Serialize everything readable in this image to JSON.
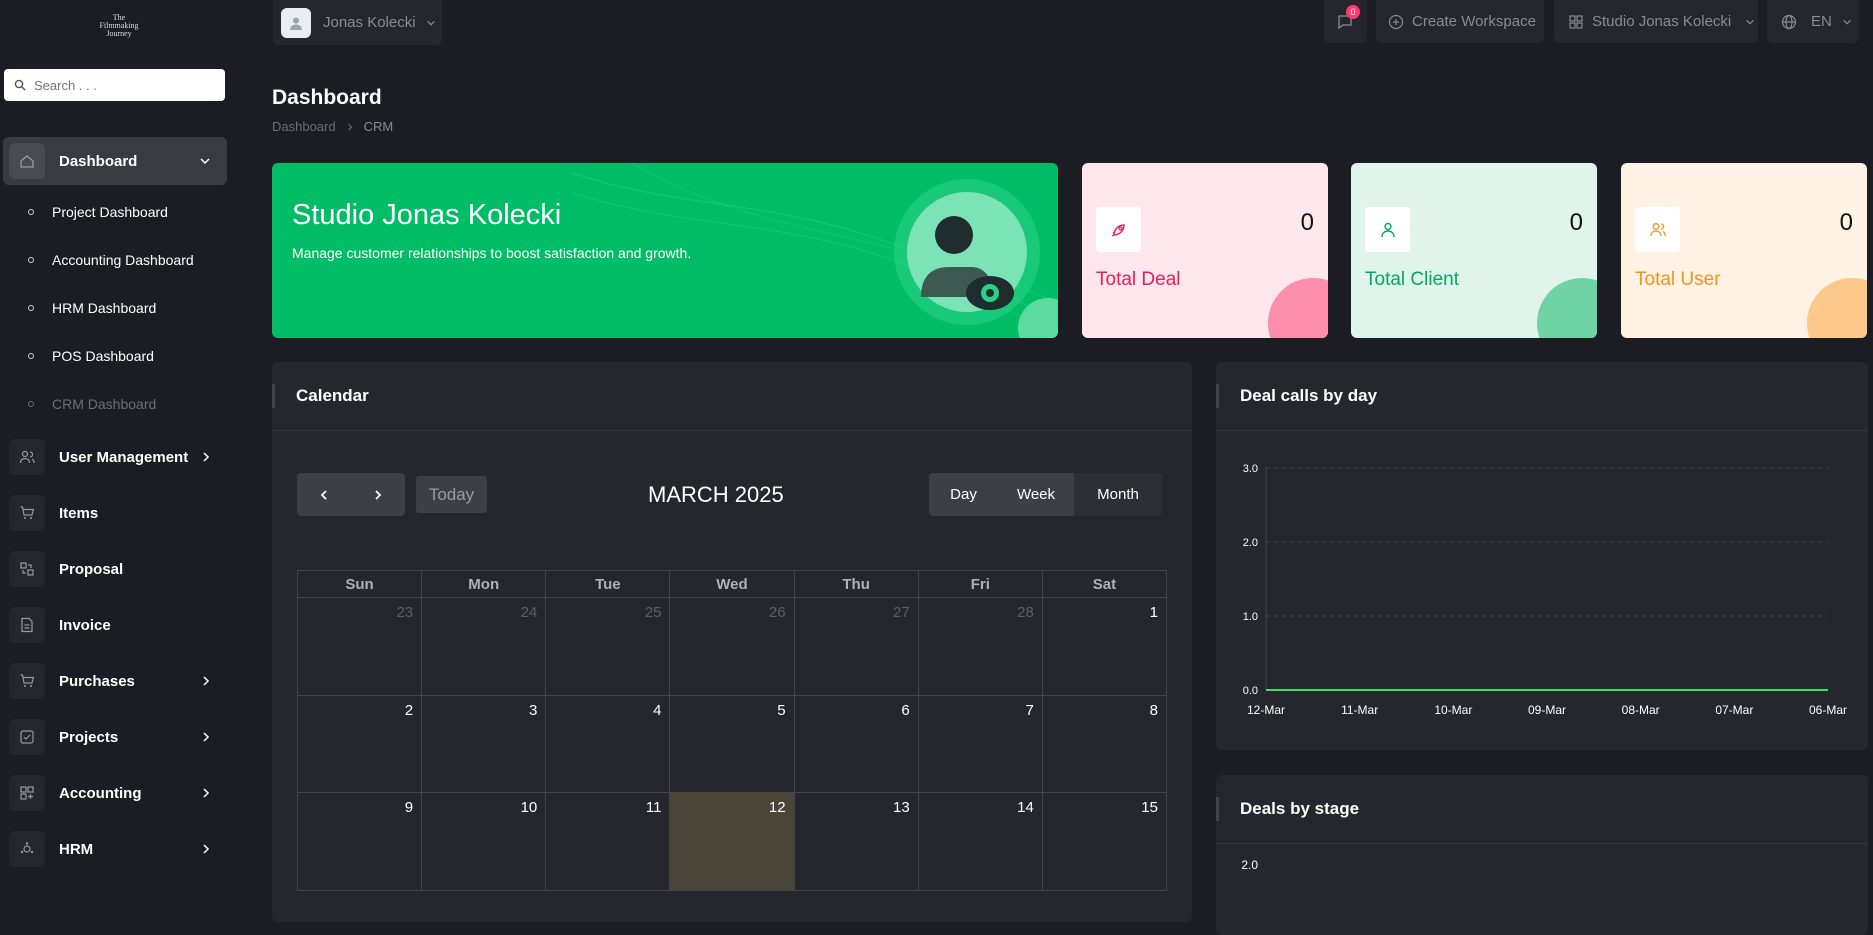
{
  "app": {
    "logo_text": "The Filmmaking Journey"
  },
  "search": {
    "placeholder": "Search . . ."
  },
  "sidebar": {
    "dashboard_label": "Dashboard",
    "sub_items": [
      {
        "label": "Project Dashboard"
      },
      {
        "label": "Accounting Dashboard"
      },
      {
        "label": "HRM Dashboard"
      },
      {
        "label": "POS Dashboard"
      },
      {
        "label": "CRM Dashboard"
      }
    ],
    "items": [
      {
        "label": "User Management",
        "icon": "users-icon",
        "chevron": true
      },
      {
        "label": "Items",
        "icon": "cart-icon",
        "chevron": false
      },
      {
        "label": "Proposal",
        "icon": "proposal-icon",
        "chevron": false
      },
      {
        "label": "Invoice",
        "icon": "invoice-icon",
        "chevron": false
      },
      {
        "label": "Purchases",
        "icon": "cart-icon",
        "chevron": true
      },
      {
        "label": "Projects",
        "icon": "check-square-icon",
        "chevron": true
      },
      {
        "label": "Accounting",
        "icon": "grid-icon",
        "chevron": true
      },
      {
        "label": "HRM",
        "icon": "hrm-icon",
        "chevron": true
      }
    ]
  },
  "topbar": {
    "user_name": "Jonas Kolecki",
    "notification_count": "0",
    "create_workspace": "Create Workspace",
    "workspace_name": "Studio Jonas Kolecki",
    "language": "EN"
  },
  "page": {
    "title": "Dashboard",
    "breadcrumb": [
      "Dashboard",
      "CRM"
    ]
  },
  "hero": {
    "title": "Studio Jonas Kolecki",
    "subtitle": "Manage customer relationships to boost satisfaction and growth."
  },
  "kpis": [
    {
      "label": "Total Deal",
      "value": "0",
      "color": "#ea1c5c",
      "bg": "#fde7ec",
      "blob": "#fb8fab"
    },
    {
      "label": "Total Client",
      "value": "0",
      "color": "#00a862",
      "bg": "#e1f4ec",
      "blob": "#6fd3a6"
    },
    {
      "label": "Total User",
      "value": "0",
      "color": "#f0931e",
      "bg": "#fdf2e3",
      "blob": "#fdc98a"
    }
  ],
  "calendar": {
    "title": "Calendar",
    "today_label": "Today",
    "month_title": "MARCH 2025",
    "views": [
      "Day",
      "Week",
      "Month"
    ],
    "active_view": "Month",
    "weekdays": [
      "Sun",
      "Mon",
      "Tue",
      "Wed",
      "Thu",
      "Fri",
      "Sat"
    ],
    "weeks": [
      [
        "23",
        "24",
        "25",
        "26",
        "27",
        "28",
        "1"
      ],
      [
        "2",
        "3",
        "4",
        "5",
        "6",
        "7",
        "8"
      ],
      [
        "9",
        "10",
        "11",
        "12",
        "13",
        "14",
        "15"
      ]
    ],
    "highlighted_day": "12"
  },
  "deal_calls": {
    "title": "Deal calls by day"
  },
  "deals_by_stage": {
    "title": "Deals by stage"
  },
  "chart_data": [
    {
      "type": "line",
      "title": "Deal calls by day",
      "x": [
        "12-Mar",
        "11-Mar",
        "10-Mar",
        "09-Mar",
        "08-Mar",
        "07-Mar",
        "06-Mar"
      ],
      "series": [
        {
          "values": [
            0,
            0,
            0,
            0,
            0,
            0,
            0
          ]
        }
      ],
      "ylim": [
        0,
        3
      ],
      "yticks": [
        "0.0",
        "1.0",
        "2.0",
        "3.0"
      ],
      "grid": true,
      "color": "#4cd964"
    },
    {
      "type": "bar",
      "title": "Deals by stage",
      "yticks": [
        "2.0"
      ]
    }
  ]
}
